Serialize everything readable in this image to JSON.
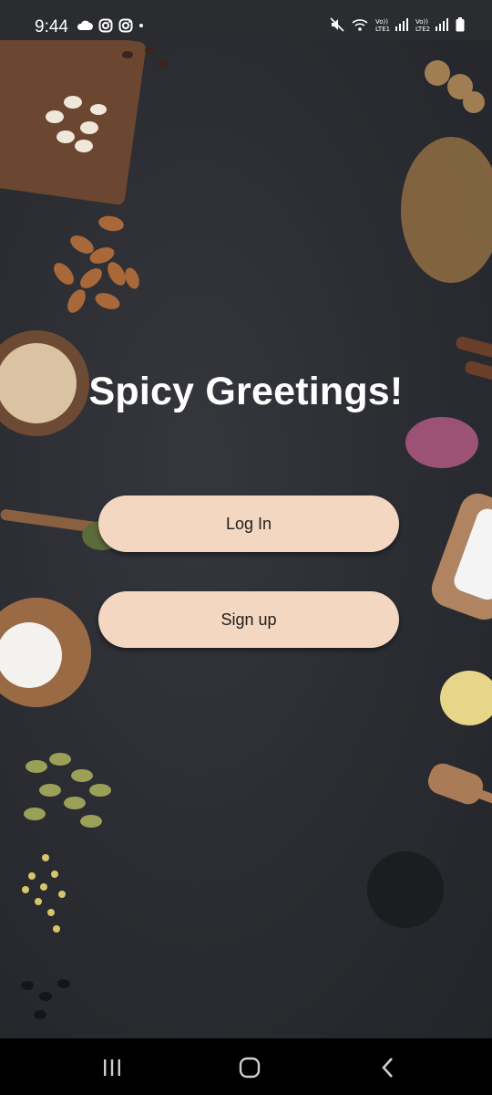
{
  "status_bar": {
    "time": "9:44",
    "left_icons": [
      "cloud-icon",
      "instagram-icon",
      "instagram-icon",
      "dot-icon"
    ],
    "right_icons": [
      "mute-icon",
      "wifi-icon",
      "lte1-signal-icon",
      "lte2-signal-icon",
      "battery-icon"
    ],
    "lte1_label": "Vo))\nLTE1",
    "lte2_label": "Vo))\nLTE2"
  },
  "main": {
    "title": "Spicy Greetings!",
    "login_label": "Log In",
    "signup_label": "Sign up"
  },
  "nav_bar": {
    "items": [
      "recent-apps-icon",
      "home-icon",
      "back-icon"
    ]
  },
  "colors": {
    "button_bg": "#f3d7c1",
    "background": "#2c2e33",
    "title": "#ffffff"
  }
}
